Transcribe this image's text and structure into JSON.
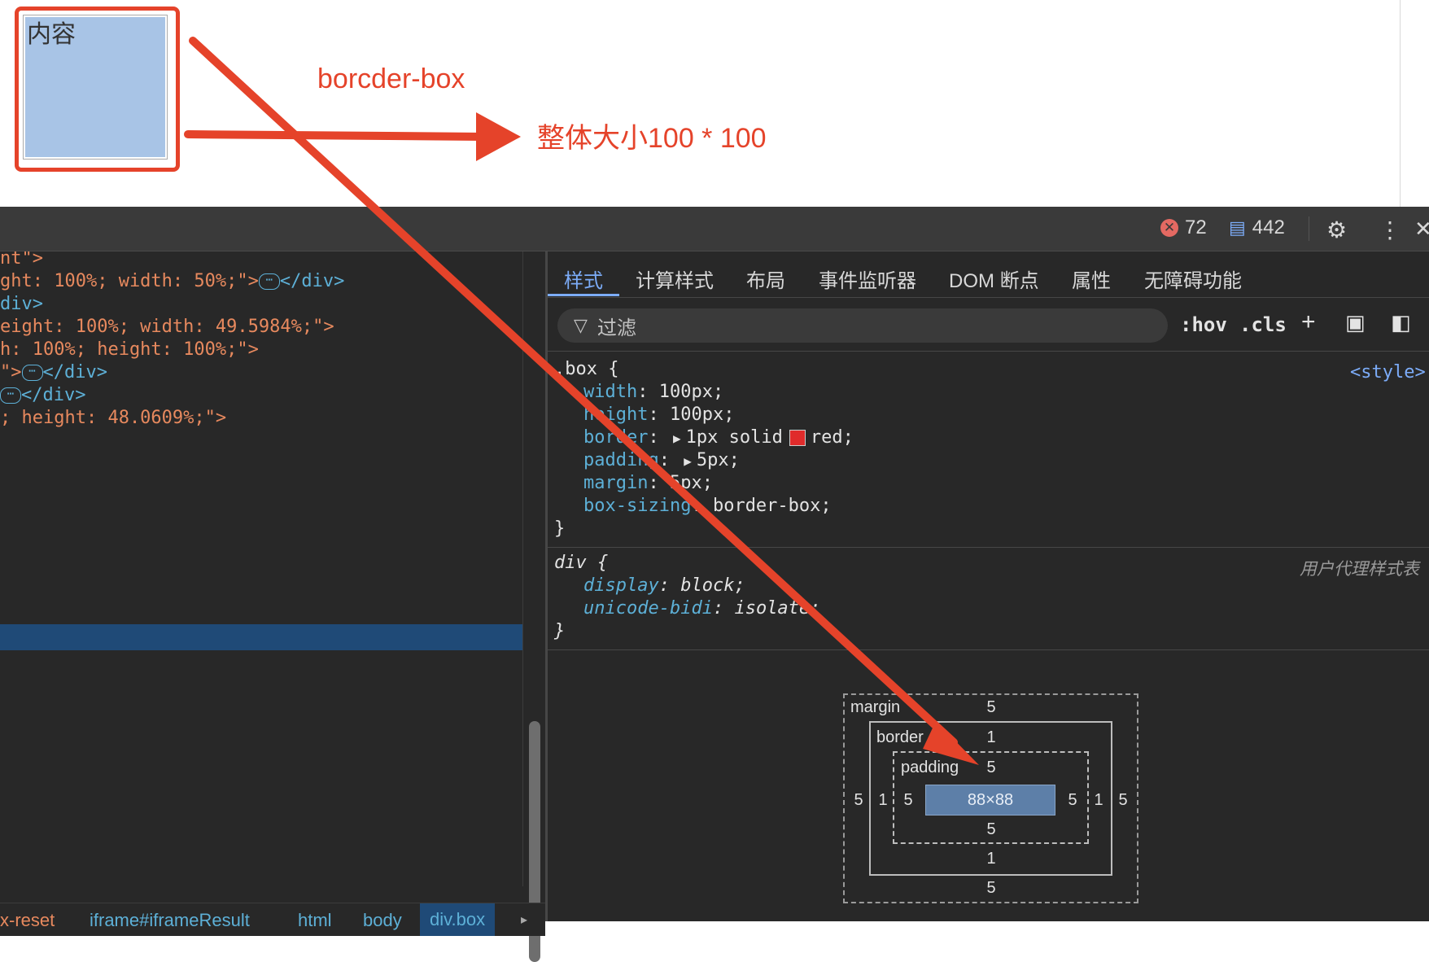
{
  "preview": {
    "box_text": "内容",
    "annotation_top": "borcder-box",
    "annotation_right": "整体大小100 * 100",
    "annotation_color": "#e5432a"
  },
  "toolbar": {
    "error_count": "72",
    "message_count": "442"
  },
  "elements": {
    "lines": [
      {
        "attr": "nt\">",
        "tail": ""
      },
      {
        "attr": "ght: 100%; width: 50%;\">",
        "tail": "</div>"
      },
      {
        "attr": "",
        "tail": "div>"
      },
      {
        "attr": "eight: 100%; width: 49.5984%;\">",
        "tail": ""
      },
      {
        "attr": "h: 100%; height: 100%;\">",
        "tail": ""
      },
      {
        "attr": "\">",
        "tail": "</div>"
      },
      {
        "attr": "",
        "tail": "</div>"
      },
      {
        "attr": "; height: 48.0609%;\">",
        "tail": ""
      }
    ],
    "breadcrumbs": [
      "x-reset",
      "iframe#iframeResult",
      "html",
      "body",
      "div.box"
    ]
  },
  "styles": {
    "tabs": [
      "样式",
      "计算样式",
      "布局",
      "事件监听器",
      "DOM 断点",
      "属性",
      "无障碍功能"
    ],
    "filter_placeholder": "过滤",
    "hov": ":hov",
    "cls": ".cls",
    "rule1": {
      "selector": ".box {",
      "source": "<style>",
      "props": [
        {
          "name": "width",
          "value": "100px;"
        },
        {
          "name": "height",
          "value": "100px;"
        },
        {
          "name": "border",
          "value": "1px solid",
          "color": "red",
          "color_hex": "#e02b2b"
        },
        {
          "name": "padding",
          "value": "5px;"
        },
        {
          "name": "margin",
          "value": "5px;"
        },
        {
          "name": "box-sizing",
          "value": "border-box;"
        }
      ],
      "close": "}"
    },
    "rule2": {
      "selector": "div {",
      "source": "用户代理样式表",
      "props": [
        {
          "name": "display",
          "value": "block;"
        },
        {
          "name": "unicode-bidi",
          "value": "isolate;"
        }
      ],
      "close": "}"
    }
  },
  "box_model": {
    "margin_label": "margin",
    "border_label": "border",
    "padding_label": "padding",
    "margin": {
      "top": "5",
      "right": "5",
      "bottom": "5",
      "left": "5"
    },
    "border": {
      "top": "1",
      "right": "1",
      "bottom": "1",
      "left": "1"
    },
    "padding": {
      "top": "5",
      "right": "5",
      "bottom": "5",
      "left": "5"
    },
    "content": "88×88"
  }
}
